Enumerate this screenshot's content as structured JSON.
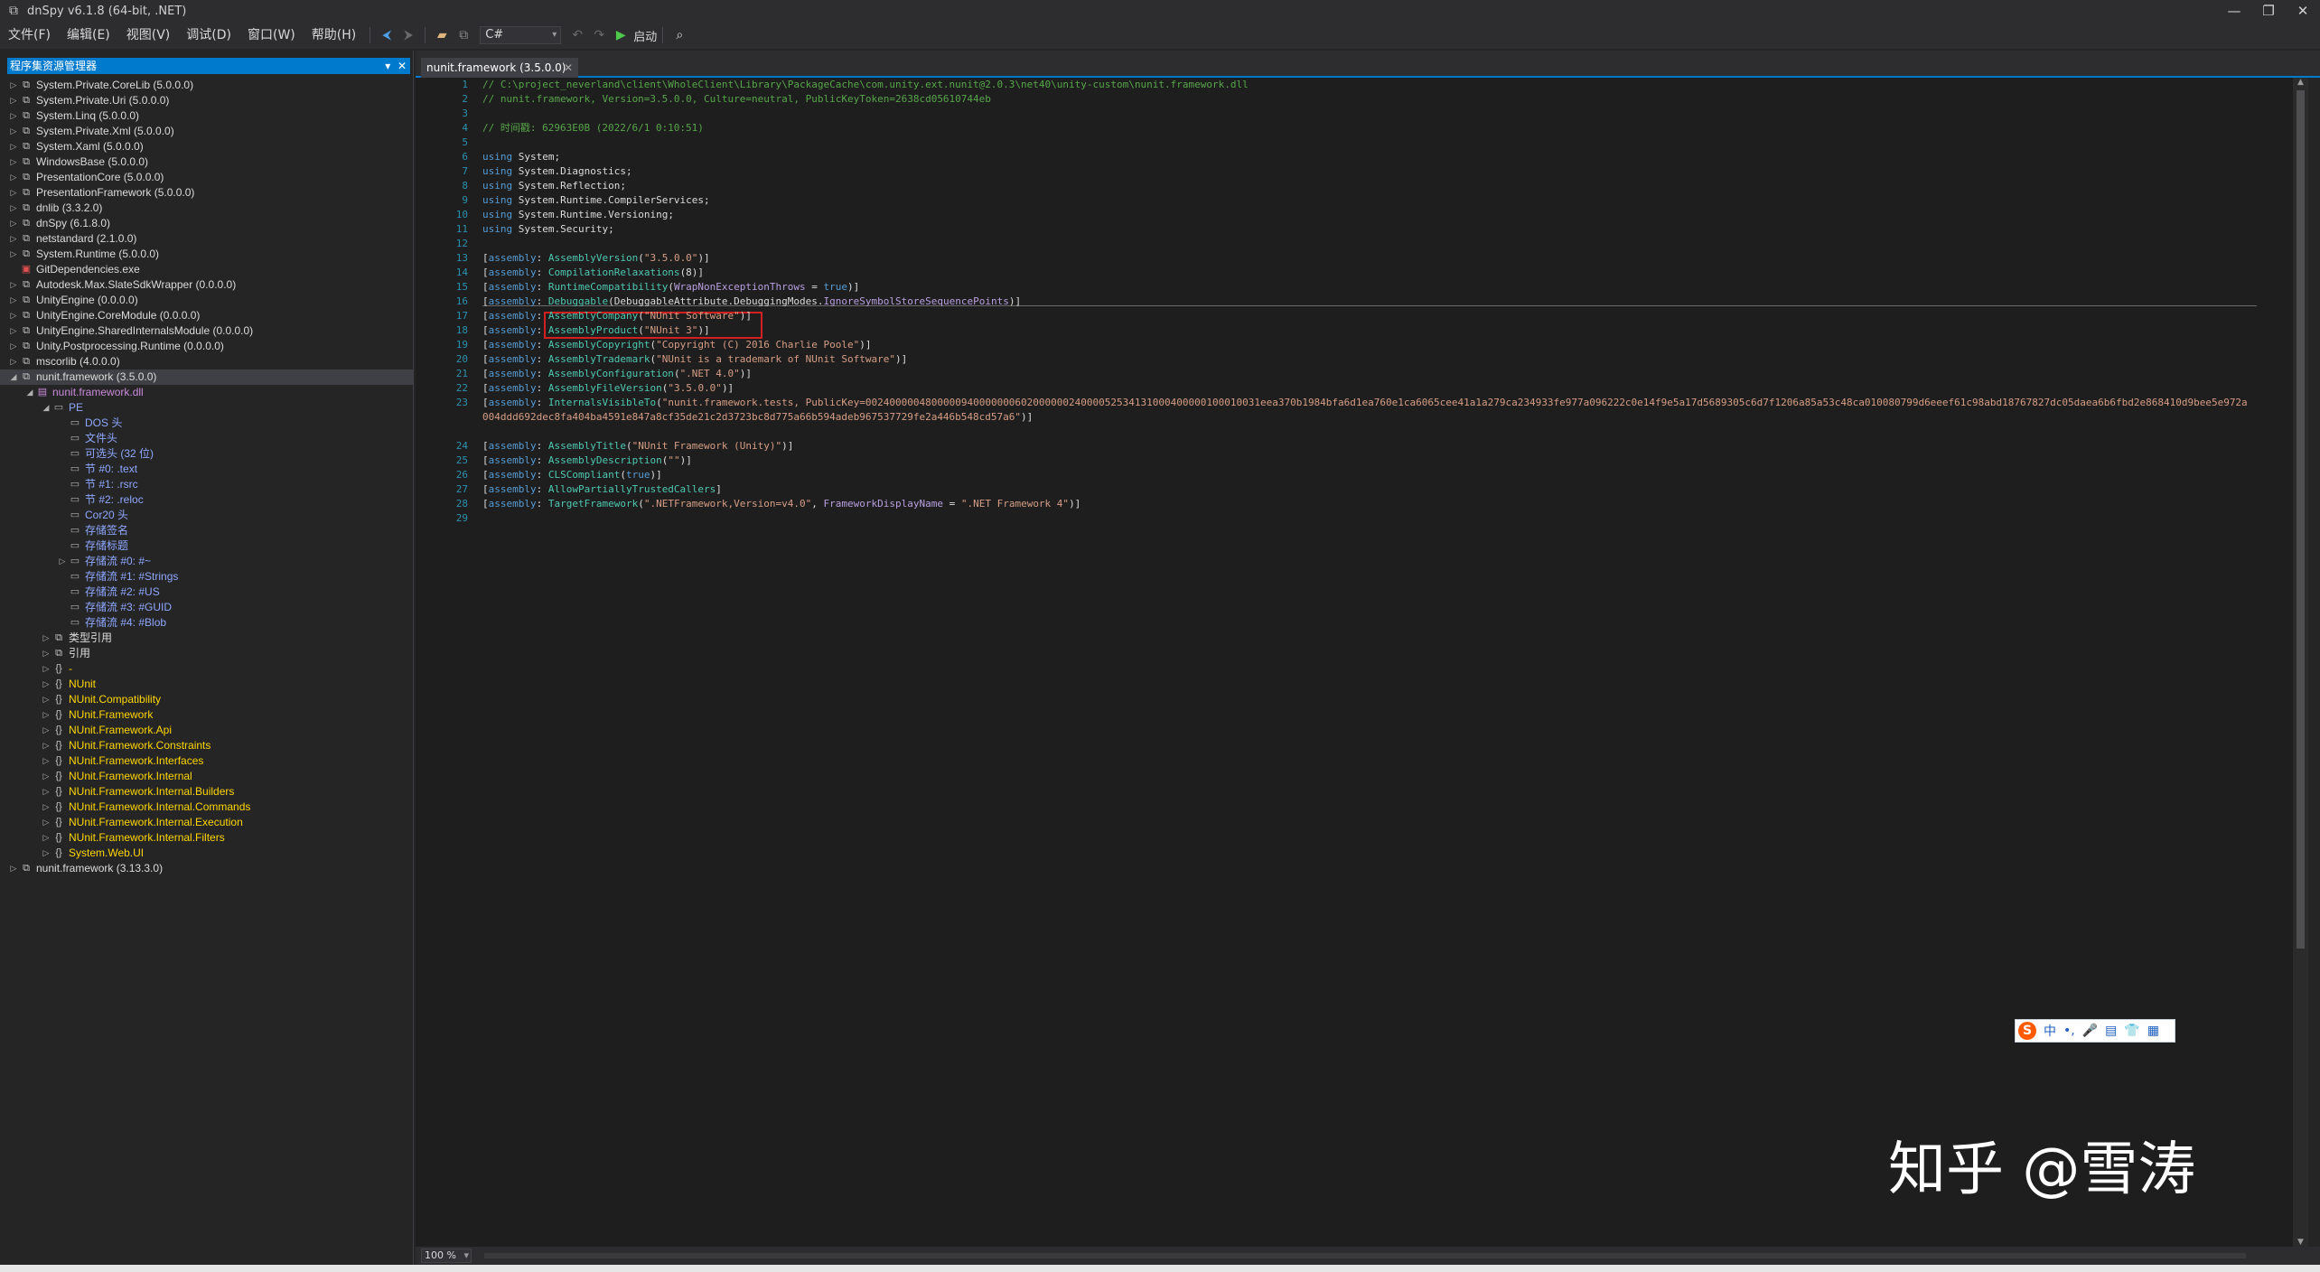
{
  "window": {
    "title": "dnSpy v6.1.8 (64-bit, .NET)",
    "minimize": "—",
    "maximize": "❐",
    "close": "✕"
  },
  "menu": {
    "items": [
      "文件(F)",
      "编辑(E)",
      "视图(V)",
      "调试(D)",
      "窗口(W)",
      "帮助(H)"
    ],
    "language": "C#",
    "run_label": "启动"
  },
  "explorer": {
    "title": "程序集资源管理器",
    "nodes": [
      {
        "text": "System.Private.CoreLib (5.0.0.0)",
        "kind": "asm",
        "level": 0,
        "toggle": "▷"
      },
      {
        "text": "System.Private.Uri (5.0.0.0)",
        "kind": "asm",
        "level": 0,
        "toggle": "▷"
      },
      {
        "text": "System.Linq (5.0.0.0)",
        "kind": "asm",
        "level": 0,
        "toggle": "▷"
      },
      {
        "text": "System.Private.Xml (5.0.0.0)",
        "kind": "asm",
        "level": 0,
        "toggle": "▷"
      },
      {
        "text": "System.Xaml (5.0.0.0)",
        "kind": "asm",
        "level": 0,
        "toggle": "▷"
      },
      {
        "text": "WindowsBase (5.0.0.0)",
        "kind": "asm",
        "level": 0,
        "toggle": "▷"
      },
      {
        "text": "PresentationCore (5.0.0.0)",
        "kind": "asm",
        "level": 0,
        "toggle": "▷"
      },
      {
        "text": "PresentationFramework (5.0.0.0)",
        "kind": "asm",
        "level": 0,
        "toggle": "▷"
      },
      {
        "text": "dnlib (3.3.2.0)",
        "kind": "asm",
        "level": 0,
        "toggle": "▷"
      },
      {
        "text": "dnSpy (6.1.8.0)",
        "kind": "asm",
        "level": 0,
        "toggle": "▷"
      },
      {
        "text": "netstandard (2.1.0.0)",
        "kind": "asm",
        "level": 0,
        "toggle": "▷"
      },
      {
        "text": "System.Runtime (5.0.0.0)",
        "kind": "asm",
        "level": 0,
        "toggle": "▷"
      },
      {
        "text": "GitDependencies.exe",
        "kind": "exe",
        "level": 0,
        "toggle": ""
      },
      {
        "text": "Autodesk.Max.SlateSdkWrapper (0.0.0.0)",
        "kind": "asm",
        "level": 0,
        "toggle": "▷"
      },
      {
        "text": "UnityEngine (0.0.0.0)",
        "kind": "asm",
        "level": 0,
        "toggle": "▷"
      },
      {
        "text": "UnityEngine.CoreModule (0.0.0.0)",
        "kind": "asm",
        "level": 0,
        "toggle": "▷"
      },
      {
        "text": "UnityEngine.SharedInternalsModule (0.0.0.0)",
        "kind": "asm",
        "level": 0,
        "toggle": "▷"
      },
      {
        "text": "Unity.Postprocessing.Runtime (0.0.0.0)",
        "kind": "asm",
        "level": 0,
        "toggle": "▷"
      },
      {
        "text": "mscorlib (4.0.0.0)",
        "kind": "asm",
        "level": 0,
        "toggle": "▷"
      },
      {
        "text": "nunit.framework (3.5.0.0)",
        "kind": "asm",
        "level": 0,
        "toggle": "◢",
        "selected": true
      },
      {
        "text": "nunit.framework.dll",
        "kind": "mod",
        "level": 1,
        "toggle": "◢"
      },
      {
        "text": "PE",
        "kind": "hdr",
        "level": 2,
        "toggle": "◢"
      },
      {
        "text": "DOS 头",
        "kind": "hdr",
        "level": 3,
        "toggle": ""
      },
      {
        "text": "文件头",
        "kind": "hdr",
        "level": 3,
        "toggle": ""
      },
      {
        "text": "可选头 (32 位)",
        "kind": "hdr",
        "level": 3,
        "toggle": ""
      },
      {
        "text": "节 #0: .text",
        "kind": "hdr",
        "level": 3,
        "toggle": ""
      },
      {
        "text": "节 #1: .rsrc",
        "kind": "hdr",
        "level": 3,
        "toggle": ""
      },
      {
        "text": "节 #2: .reloc",
        "kind": "hdr",
        "level": 3,
        "toggle": ""
      },
      {
        "text": "Cor20 头",
        "kind": "hdr",
        "level": 3,
        "toggle": ""
      },
      {
        "text": "存储签名",
        "kind": "hdr",
        "level": 3,
        "toggle": ""
      },
      {
        "text": "存储标题",
        "kind": "hdr",
        "level": 3,
        "toggle": ""
      },
      {
        "text": "存储流 #0: #~",
        "kind": "hdr",
        "level": 3,
        "toggle": "▷"
      },
      {
        "text": "存储流 #1: #Strings",
        "kind": "hdr",
        "level": 3,
        "toggle": ""
      },
      {
        "text": "存储流 #2: #US",
        "kind": "hdr",
        "level": 3,
        "toggle": ""
      },
      {
        "text": "存储流 #3: #GUID",
        "kind": "hdr",
        "level": 3,
        "toggle": ""
      },
      {
        "text": "存储流 #4: #Blob",
        "kind": "hdr",
        "level": 3,
        "toggle": ""
      },
      {
        "text": "类型引用",
        "kind": "asm",
        "level": 2,
        "toggle": "▷"
      },
      {
        "text": "引用",
        "kind": "asm",
        "level": 2,
        "toggle": "▷"
      },
      {
        "text": "-",
        "kind": "ns",
        "level": 2,
        "toggle": "▷"
      },
      {
        "text": "NUnit",
        "kind": "ns",
        "level": 2,
        "toggle": "▷"
      },
      {
        "text": "NUnit.Compatibility",
        "kind": "ns",
        "level": 2,
        "toggle": "▷"
      },
      {
        "text": "NUnit.Framework",
        "kind": "ns",
        "level": 2,
        "toggle": "▷"
      },
      {
        "text": "NUnit.Framework.Api",
        "kind": "ns",
        "level": 2,
        "toggle": "▷"
      },
      {
        "text": "NUnit.Framework.Constraints",
        "kind": "ns",
        "level": 2,
        "toggle": "▷"
      },
      {
        "text": "NUnit.Framework.Interfaces",
        "kind": "ns",
        "level": 2,
        "toggle": "▷"
      },
      {
        "text": "NUnit.Framework.Internal",
        "kind": "ns",
        "level": 2,
        "toggle": "▷"
      },
      {
        "text": "NUnit.Framework.Internal.Builders",
        "kind": "ns",
        "level": 2,
        "toggle": "▷"
      },
      {
        "text": "NUnit.Framework.Internal.Commands",
        "kind": "ns",
        "level": 2,
        "toggle": "▷"
      },
      {
        "text": "NUnit.Framework.Internal.Execution",
        "kind": "ns",
        "level": 2,
        "toggle": "▷"
      },
      {
        "text": "NUnit.Framework.Internal.Filters",
        "kind": "ns",
        "level": 2,
        "toggle": "▷"
      },
      {
        "text": "System.Web.UI",
        "kind": "ns",
        "level": 2,
        "toggle": "▷"
      },
      {
        "text": "nunit.framework (3.13.3.0)",
        "kind": "asm",
        "level": 0,
        "toggle": "▷"
      }
    ]
  },
  "editor": {
    "tab_title": "nunit.framework (3.5.0.0)",
    "lines": [
      [
        [
          "cmt",
          "// C:\\project_neverland\\client\\WholeClient\\Library\\PackageCache\\com.unity.ext.nunit@2.0.3\\net40\\unity-custom\\nunit.framework.dll"
        ]
      ],
      [
        [
          "cmt",
          "// nunit.framework, Version=3.5.0.0, Culture=neutral, PublicKeyToken=2638cd05610744eb"
        ]
      ],
      [],
      [
        [
          "cmt",
          "// 时间戳: 62963E0B (2022/6/1 0:10:51)"
        ]
      ],
      [],
      [
        [
          "kw",
          "using "
        ],
        [
          "id",
          "System;"
        ]
      ],
      [
        [
          "kw",
          "using "
        ],
        [
          "id",
          "System.Diagnostics;"
        ]
      ],
      [
        [
          "kw",
          "using "
        ],
        [
          "id",
          "System.Reflection;"
        ]
      ],
      [
        [
          "kw",
          "using "
        ],
        [
          "id",
          "System.Runtime.CompilerServices;"
        ]
      ],
      [
        [
          "kw",
          "using "
        ],
        [
          "id",
          "System.Runtime.Versioning;"
        ]
      ],
      [
        [
          "kw",
          "using "
        ],
        [
          "id",
          "System.Security;"
        ]
      ],
      [],
      [
        [
          "id",
          "["
        ],
        [
          "kw",
          "assembly"
        ],
        [
          "id",
          ": "
        ],
        [
          "typ",
          "AssemblyVersion"
        ],
        [
          "id",
          "("
        ],
        [
          "str",
          "\"3.5.0.0\""
        ],
        [
          "id",
          ")]"
        ]
      ],
      [
        [
          "id",
          "["
        ],
        [
          "kw",
          "assembly"
        ],
        [
          "id",
          ": "
        ],
        [
          "typ",
          "CompilationRelaxations"
        ],
        [
          "id",
          "(8)]"
        ]
      ],
      [
        [
          "id",
          "["
        ],
        [
          "kw",
          "assembly"
        ],
        [
          "id",
          ": "
        ],
        [
          "typ",
          "RuntimeCompatibility"
        ],
        [
          "id",
          "("
        ],
        [
          "prp",
          "WrapNonExceptionThrows"
        ],
        [
          "id",
          " = "
        ],
        [
          "kw",
          "true"
        ],
        [
          "id",
          ")]"
        ]
      ],
      [
        [
          "id",
          "["
        ],
        [
          "kw",
          "assembly"
        ],
        [
          "id",
          ": "
        ],
        [
          "typ",
          "Debuggable"
        ],
        [
          "id",
          "(DebuggableAttribute.DebuggingModes."
        ],
        [
          "prp",
          "IgnoreSymbolStoreSequencePoints"
        ],
        [
          "id",
          ")]"
        ]
      ],
      [
        [
          "id",
          "["
        ],
        [
          "kw",
          "assembly"
        ],
        [
          "id",
          ": "
        ],
        [
          "typ",
          "AssemblyCompany"
        ],
        [
          "id",
          "("
        ],
        [
          "str",
          "\"NUnit Software\""
        ],
        [
          "id",
          ")]"
        ]
      ],
      [
        [
          "id",
          "["
        ],
        [
          "kw",
          "assembly"
        ],
        [
          "id",
          ": "
        ],
        [
          "typ",
          "AssemblyProduct"
        ],
        [
          "id",
          "("
        ],
        [
          "str",
          "\"NUnit 3\""
        ],
        [
          "id",
          ")]"
        ]
      ],
      [
        [
          "id",
          "["
        ],
        [
          "kw",
          "assembly"
        ],
        [
          "id",
          ": "
        ],
        [
          "typ",
          "AssemblyCopyright"
        ],
        [
          "id",
          "("
        ],
        [
          "str",
          "\"Copyright (C) 2016 Charlie Poole\""
        ],
        [
          "id",
          ")]"
        ]
      ],
      [
        [
          "id",
          "["
        ],
        [
          "kw",
          "assembly"
        ],
        [
          "id",
          ": "
        ],
        [
          "typ",
          "AssemblyTrademark"
        ],
        [
          "id",
          "("
        ],
        [
          "str",
          "\"NUnit is a trademark of NUnit Software\""
        ],
        [
          "id",
          ")]"
        ]
      ],
      [
        [
          "id",
          "["
        ],
        [
          "kw",
          "assembly"
        ],
        [
          "id",
          ": "
        ],
        [
          "typ",
          "AssemblyConfiguration"
        ],
        [
          "id",
          "("
        ],
        [
          "str",
          "\".NET 4.0\""
        ],
        [
          "id",
          ")]"
        ]
      ],
      [
        [
          "id",
          "["
        ],
        [
          "kw",
          "assembly"
        ],
        [
          "id",
          ": "
        ],
        [
          "typ",
          "AssemblyFileVersion"
        ],
        [
          "id",
          "("
        ],
        [
          "str",
          "\"3.5.0.0\""
        ],
        [
          "id",
          ")]"
        ]
      ],
      [
        [
          "id",
          "["
        ],
        [
          "kw",
          "assembly"
        ],
        [
          "id",
          ": "
        ],
        [
          "typ",
          "InternalsVisibleTo"
        ],
        [
          "id",
          "("
        ],
        [
          "str",
          "\"nunit.framework.tests, PublicKey=002400000480000094000000060200000024000052534131000400000100010031eea370b1984bfa6d1ea760e1ca6065cee41a1a279ca234933fe977a096222c0e14f9e5a17d5689305c6d7f1206a85a53c48ca010080799d6eeef61c98abd18767827dc05daea6b6fbd2e868410d9bee5e972a004ddd692dec8fa404ba4591e847a8cf35de21c2d3723bc8d775a66b594adeb967537729fe2a446b548cd57a6\""
        ],
        [
          "id",
          ")]"
        ]
      ],
      [
        [
          "id",
          "["
        ],
        [
          "kw",
          "assembly"
        ],
        [
          "id",
          ": "
        ],
        [
          "typ",
          "AssemblyTitle"
        ],
        [
          "id",
          "("
        ],
        [
          "str",
          "\"NUnit Framework (Unity)\""
        ],
        [
          "id",
          ")]"
        ]
      ],
      [
        [
          "id",
          "["
        ],
        [
          "kw",
          "assembly"
        ],
        [
          "id",
          ": "
        ],
        [
          "typ",
          "AssemblyDescription"
        ],
        [
          "id",
          "("
        ],
        [
          "str",
          "\"\""
        ],
        [
          "id",
          ")]"
        ]
      ],
      [
        [
          "id",
          "["
        ],
        [
          "kw",
          "assembly"
        ],
        [
          "id",
          ": "
        ],
        [
          "typ",
          "CLSCompliant"
        ],
        [
          "id",
          "("
        ],
        [
          "kw",
          "true"
        ],
        [
          "id",
          ")]"
        ]
      ],
      [
        [
          "id",
          "["
        ],
        [
          "kw",
          "assembly"
        ],
        [
          "id",
          ": "
        ],
        [
          "typ",
          "AllowPartiallyTrustedCallers"
        ],
        [
          "id",
          "]"
        ]
      ],
      [
        [
          "id",
          "["
        ],
        [
          "kw",
          "assembly"
        ],
        [
          "id",
          ": "
        ],
        [
          "typ",
          "TargetFramework"
        ],
        [
          "id",
          "("
        ],
        [
          "str",
          "\".NETFramework,Version=v4.0\""
        ],
        [
          "id",
          ", "
        ],
        [
          "prp",
          "FrameworkDisplayName"
        ],
        [
          "id",
          " = "
        ],
        [
          "str",
          "\".NET Framework 4\""
        ],
        [
          "id",
          ")]"
        ]
      ],
      []
    ],
    "zoom": "100 %"
  },
  "ime": {
    "logo": "S",
    "chars": [
      "中",
      "•,",
      "🎤",
      "▤",
      "👕",
      "▦"
    ]
  },
  "watermark": "知乎 @雪涛"
}
